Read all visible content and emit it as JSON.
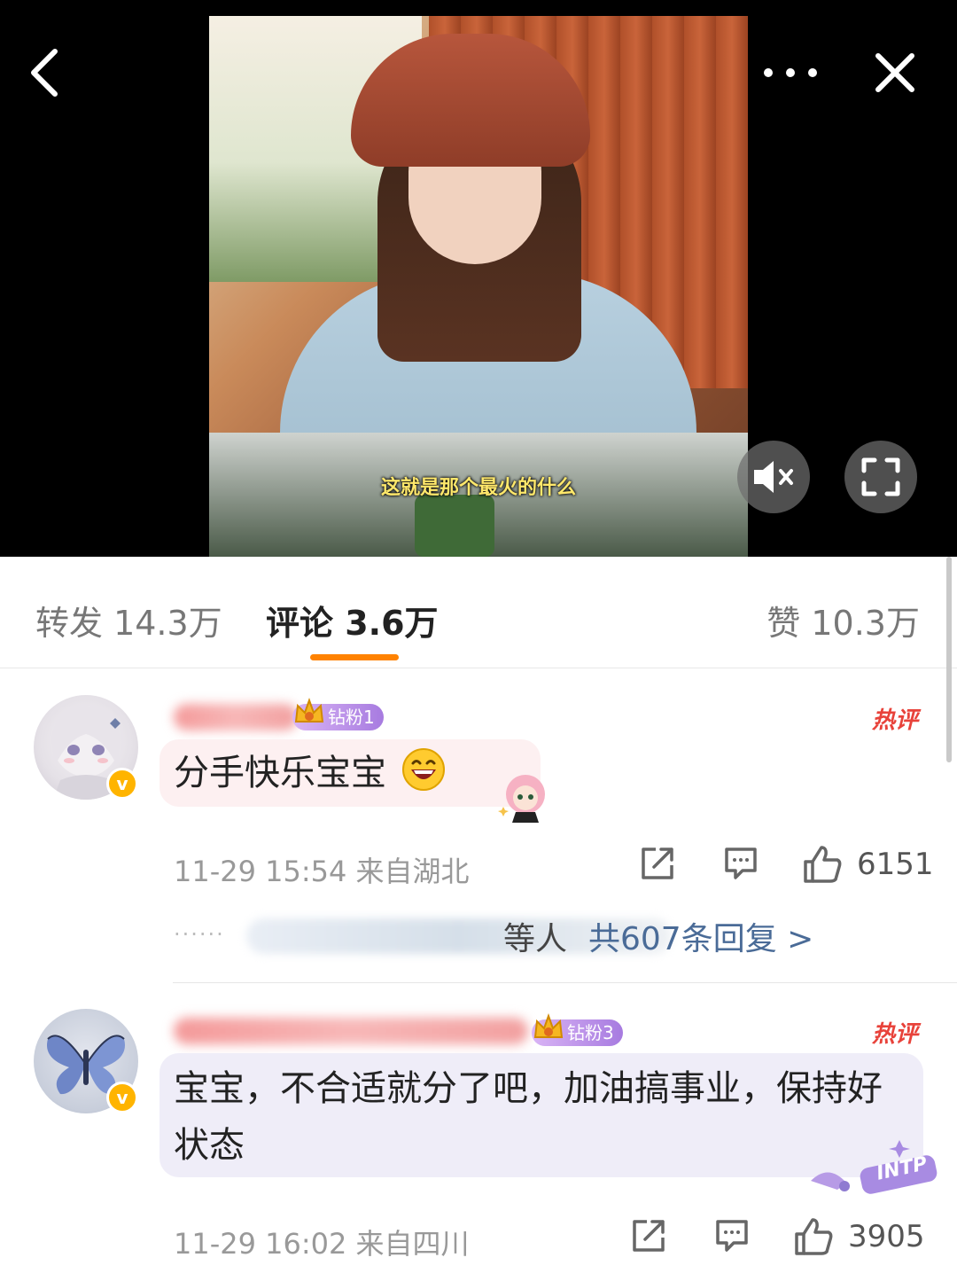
{
  "video": {
    "subtitle": "这就是那个最火的什么",
    "icons": {
      "back": "chevron-left-icon",
      "more": "more-dots-icon",
      "close": "close-icon",
      "mute": "mute-icon",
      "fullscreen": "fullscreen-icon"
    }
  },
  "tabs": {
    "repost_label": "转发 14.3万",
    "comment_label": "评论 3.6万",
    "like_label": "赞 10.3万",
    "active_underline_color": "#ff8200"
  },
  "comments": [
    {
      "badge": "钻粉1",
      "hot_tag": "热评",
      "text": "分手快乐宝宝",
      "timestamp": "11-29 15:54",
      "location": "来自湖北",
      "likes": "6151",
      "reply_suffix": "等人",
      "reply_link": "共607条回复 >"
    },
    {
      "badge": "钻粉3",
      "hot_tag": "热评",
      "text": "宝宝，不合适就分了吧，加油搞事业，保持好状态",
      "timestamp": "11-29 16:02",
      "location": "来自四川",
      "likes": "3905",
      "deco_text": "INTP"
    }
  ],
  "colors": {
    "hot": "#e8423a",
    "badge": "#b48be6",
    "verified": "#ffb400",
    "link": "#4a6b97"
  }
}
